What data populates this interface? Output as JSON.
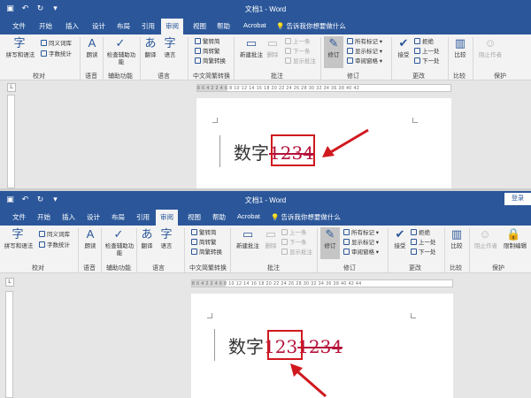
{
  "window": {
    "title": "文档1 - Word",
    "login_label": "登录"
  },
  "quick_access": [
    "save-icon",
    "undo-icon",
    "redo-icon",
    "customize-icon"
  ],
  "tabs": [
    "文件",
    "开始",
    "插入",
    "设计",
    "布局",
    "引用",
    "审阅",
    "视图",
    "帮助",
    "Acrobat"
  ],
  "active_tab": "审阅",
  "tell_me": "告诉我你想要做什么",
  "ribbon": {
    "proofing": {
      "spelling": "拼写和语法",
      "thesaurus": "同义词库",
      "word_count": "字数统计",
      "label": "校对"
    },
    "speech": {
      "read_aloud": "朗读",
      "label": "语音"
    },
    "accessibility": {
      "check": "检查辅助功能",
      "label": "辅助功能"
    },
    "language": {
      "translate": "翻译",
      "language": "语言",
      "label": "语言"
    },
    "chinese_conversion": {
      "to_simplified": "繁转简",
      "to_traditional": "简转繁",
      "convert": "简繁转换",
      "label": "中文简繁转换"
    },
    "comments": {
      "new": "新建批注",
      "delete": "删除",
      "previous": "上一条",
      "next": "下一条",
      "show": "显示批注",
      "label": "批注"
    },
    "tracking": {
      "track_changes": "修订",
      "markup": "所有标记",
      "show_markup": "显示标记",
      "reviewing_pane": "审阅窗格",
      "label": "修订"
    },
    "changes": {
      "accept": "接受",
      "reject": "拒绝",
      "previous": "上一处",
      "next": "下一处",
      "label": "更改"
    },
    "compare": {
      "compare": "比较",
      "label": "比较"
    },
    "protect": {
      "block_authors": "阻止作者",
      "restrict_editing": "限制编辑",
      "label": "保护"
    }
  },
  "ruler": {
    "top_ticks": "8 6 4 2  2 4 6 8 10 12 14 16 18 20 22 24 26 28 30 32 34 36 38 40 42",
    "bottom_ticks": "8 6 4 2  2 4 6 8 10 12 14 16 18 20 22 24 26 28 30 32 34 36 38 40 42 44"
  },
  "document_top": {
    "plain": "数字",
    "deleted": "1234"
  },
  "document_bottom": {
    "plain": "数字",
    "inserted": "123",
    "deleted": "1234"
  },
  "colors": {
    "title_bar": "#2b579a",
    "revision": "#b5123a",
    "highlight": "#d0191f"
  }
}
